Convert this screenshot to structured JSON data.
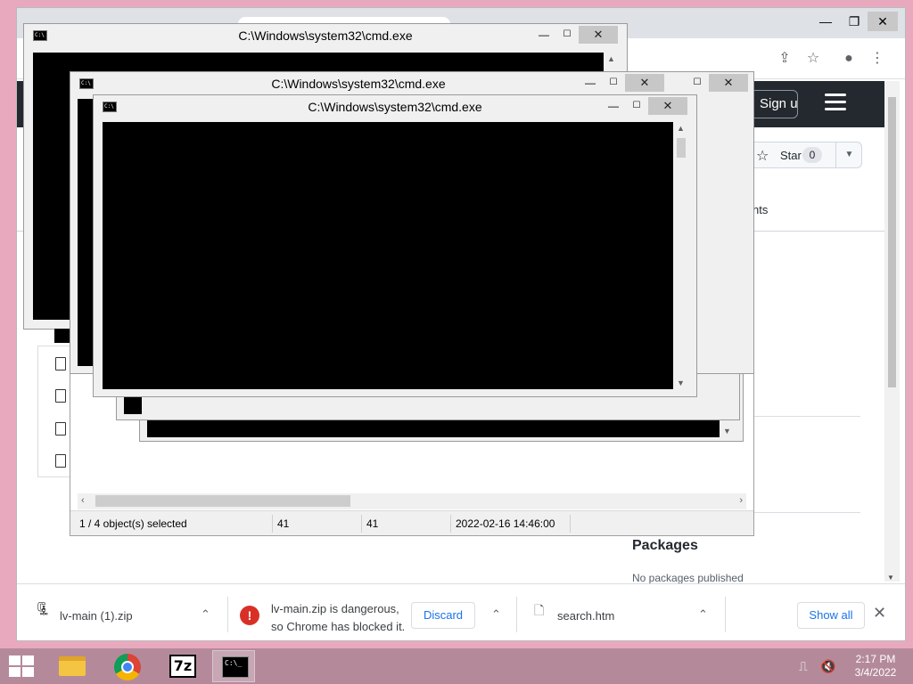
{
  "chrome": {
    "signup_label": "Sign up",
    "star_label": "Star",
    "star_count": "0",
    "tabs_fragment": "nts",
    "packages_heading": "Packages",
    "no_packages": "No packages published"
  },
  "downloads": {
    "item1_name": "lv-main (1).zip",
    "blocked_line1": "lv-main.zip is dangerous,",
    "blocked_line2": "so Chrome has blocked it.",
    "discard_label": "Discard",
    "item3_name": "search.htm",
    "show_all_label": "Show all"
  },
  "explorer": {
    "status_selected": "1 / 4 object(s) selected",
    "status_size1": "41",
    "status_size2": "41",
    "status_date": "2022-02-16 14:46:00"
  },
  "cmd_windows": {
    "title": "C:\\Windows\\system32\\cmd.exe"
  },
  "taskbar": {
    "sevenz_label": "7z",
    "cmd_label": "C:\\_",
    "time": "2:17 PM",
    "date": "3/4/2022"
  },
  "colors": {
    "wallpaper": "#e8a9be",
    "taskbar": "#b48a9b",
    "github_header": "#24292f",
    "danger": "#d93025",
    "link_blue": "#1a73e8"
  }
}
